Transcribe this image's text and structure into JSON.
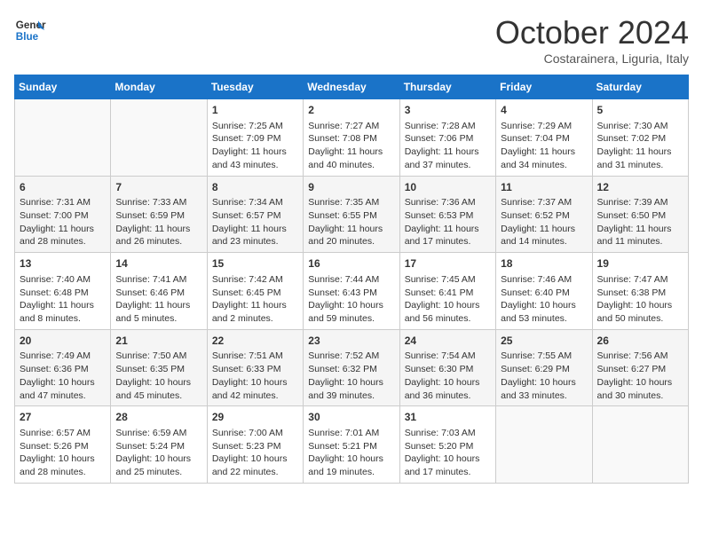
{
  "header": {
    "logo_line1": "General",
    "logo_line2": "Blue",
    "month_title": "October 2024",
    "location": "Costarainera, Liguria, Italy"
  },
  "days_of_week": [
    "Sunday",
    "Monday",
    "Tuesday",
    "Wednesday",
    "Thursday",
    "Friday",
    "Saturday"
  ],
  "weeks": [
    [
      {
        "day": "",
        "sunrise": "",
        "sunset": "",
        "daylight": ""
      },
      {
        "day": "",
        "sunrise": "",
        "sunset": "",
        "daylight": ""
      },
      {
        "day": "1",
        "sunrise": "Sunrise: 7:25 AM",
        "sunset": "Sunset: 7:09 PM",
        "daylight": "Daylight: 11 hours and 43 minutes."
      },
      {
        "day": "2",
        "sunrise": "Sunrise: 7:27 AM",
        "sunset": "Sunset: 7:08 PM",
        "daylight": "Daylight: 11 hours and 40 minutes."
      },
      {
        "day": "3",
        "sunrise": "Sunrise: 7:28 AM",
        "sunset": "Sunset: 7:06 PM",
        "daylight": "Daylight: 11 hours and 37 minutes."
      },
      {
        "day": "4",
        "sunrise": "Sunrise: 7:29 AM",
        "sunset": "Sunset: 7:04 PM",
        "daylight": "Daylight: 11 hours and 34 minutes."
      },
      {
        "day": "5",
        "sunrise": "Sunrise: 7:30 AM",
        "sunset": "Sunset: 7:02 PM",
        "daylight": "Daylight: 11 hours and 31 minutes."
      }
    ],
    [
      {
        "day": "6",
        "sunrise": "Sunrise: 7:31 AM",
        "sunset": "Sunset: 7:00 PM",
        "daylight": "Daylight: 11 hours and 28 minutes."
      },
      {
        "day": "7",
        "sunrise": "Sunrise: 7:33 AM",
        "sunset": "Sunset: 6:59 PM",
        "daylight": "Daylight: 11 hours and 26 minutes."
      },
      {
        "day": "8",
        "sunrise": "Sunrise: 7:34 AM",
        "sunset": "Sunset: 6:57 PM",
        "daylight": "Daylight: 11 hours and 23 minutes."
      },
      {
        "day": "9",
        "sunrise": "Sunrise: 7:35 AM",
        "sunset": "Sunset: 6:55 PM",
        "daylight": "Daylight: 11 hours and 20 minutes."
      },
      {
        "day": "10",
        "sunrise": "Sunrise: 7:36 AM",
        "sunset": "Sunset: 6:53 PM",
        "daylight": "Daylight: 11 hours and 17 minutes."
      },
      {
        "day": "11",
        "sunrise": "Sunrise: 7:37 AM",
        "sunset": "Sunset: 6:52 PM",
        "daylight": "Daylight: 11 hours and 14 minutes."
      },
      {
        "day": "12",
        "sunrise": "Sunrise: 7:39 AM",
        "sunset": "Sunset: 6:50 PM",
        "daylight": "Daylight: 11 hours and 11 minutes."
      }
    ],
    [
      {
        "day": "13",
        "sunrise": "Sunrise: 7:40 AM",
        "sunset": "Sunset: 6:48 PM",
        "daylight": "Daylight: 11 hours and 8 minutes."
      },
      {
        "day": "14",
        "sunrise": "Sunrise: 7:41 AM",
        "sunset": "Sunset: 6:46 PM",
        "daylight": "Daylight: 11 hours and 5 minutes."
      },
      {
        "day": "15",
        "sunrise": "Sunrise: 7:42 AM",
        "sunset": "Sunset: 6:45 PM",
        "daylight": "Daylight: 11 hours and 2 minutes."
      },
      {
        "day": "16",
        "sunrise": "Sunrise: 7:44 AM",
        "sunset": "Sunset: 6:43 PM",
        "daylight": "Daylight: 10 hours and 59 minutes."
      },
      {
        "day": "17",
        "sunrise": "Sunrise: 7:45 AM",
        "sunset": "Sunset: 6:41 PM",
        "daylight": "Daylight: 10 hours and 56 minutes."
      },
      {
        "day": "18",
        "sunrise": "Sunrise: 7:46 AM",
        "sunset": "Sunset: 6:40 PM",
        "daylight": "Daylight: 10 hours and 53 minutes."
      },
      {
        "day": "19",
        "sunrise": "Sunrise: 7:47 AM",
        "sunset": "Sunset: 6:38 PM",
        "daylight": "Daylight: 10 hours and 50 minutes."
      }
    ],
    [
      {
        "day": "20",
        "sunrise": "Sunrise: 7:49 AM",
        "sunset": "Sunset: 6:36 PM",
        "daylight": "Daylight: 10 hours and 47 minutes."
      },
      {
        "day": "21",
        "sunrise": "Sunrise: 7:50 AM",
        "sunset": "Sunset: 6:35 PM",
        "daylight": "Daylight: 10 hours and 45 minutes."
      },
      {
        "day": "22",
        "sunrise": "Sunrise: 7:51 AM",
        "sunset": "Sunset: 6:33 PM",
        "daylight": "Daylight: 10 hours and 42 minutes."
      },
      {
        "day": "23",
        "sunrise": "Sunrise: 7:52 AM",
        "sunset": "Sunset: 6:32 PM",
        "daylight": "Daylight: 10 hours and 39 minutes."
      },
      {
        "day": "24",
        "sunrise": "Sunrise: 7:54 AM",
        "sunset": "Sunset: 6:30 PM",
        "daylight": "Daylight: 10 hours and 36 minutes."
      },
      {
        "day": "25",
        "sunrise": "Sunrise: 7:55 AM",
        "sunset": "Sunset: 6:29 PM",
        "daylight": "Daylight: 10 hours and 33 minutes."
      },
      {
        "day": "26",
        "sunrise": "Sunrise: 7:56 AM",
        "sunset": "Sunset: 6:27 PM",
        "daylight": "Daylight: 10 hours and 30 minutes."
      }
    ],
    [
      {
        "day": "27",
        "sunrise": "Sunrise: 6:57 AM",
        "sunset": "Sunset: 5:26 PM",
        "daylight": "Daylight: 10 hours and 28 minutes."
      },
      {
        "day": "28",
        "sunrise": "Sunrise: 6:59 AM",
        "sunset": "Sunset: 5:24 PM",
        "daylight": "Daylight: 10 hours and 25 minutes."
      },
      {
        "day": "29",
        "sunrise": "Sunrise: 7:00 AM",
        "sunset": "Sunset: 5:23 PM",
        "daylight": "Daylight: 10 hours and 22 minutes."
      },
      {
        "day": "30",
        "sunrise": "Sunrise: 7:01 AM",
        "sunset": "Sunset: 5:21 PM",
        "daylight": "Daylight: 10 hours and 19 minutes."
      },
      {
        "day": "31",
        "sunrise": "Sunrise: 7:03 AM",
        "sunset": "Sunset: 5:20 PM",
        "daylight": "Daylight: 10 hours and 17 minutes."
      },
      {
        "day": "",
        "sunrise": "",
        "sunset": "",
        "daylight": ""
      },
      {
        "day": "",
        "sunrise": "",
        "sunset": "",
        "daylight": ""
      }
    ]
  ]
}
